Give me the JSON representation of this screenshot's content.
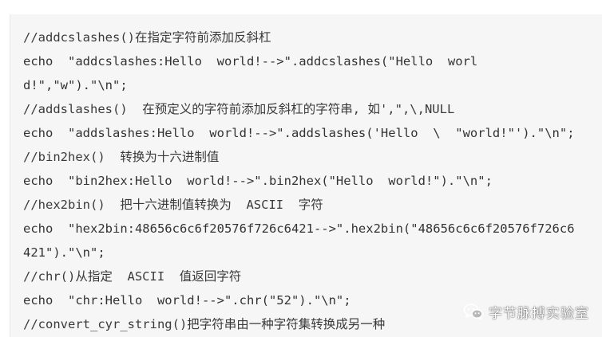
{
  "code": {
    "lines": [
      {
        "kind": "comment",
        "text": "//addcslashes()在指定字符前添加反斜杠"
      },
      {
        "kind": "code",
        "text": "echo  \"addcslashes:Hello  world!-->\".addcslashes(\"Hello  worl"
      },
      {
        "kind": "code",
        "text": "d!\",\"w\").\"\\n\";"
      },
      {
        "kind": "comment",
        "text": "//addslashes()  在预定义的字符前添加反斜杠的字符串, 如',\",\\,NULL"
      },
      {
        "kind": "code",
        "text": "echo  \"addslashes:Hello  world!-->\".addslashes('Hello  \\  \"world!\"').\"\\n\";"
      },
      {
        "kind": "comment",
        "text": "//bin2hex()  转换为十六进制值"
      },
      {
        "kind": "code",
        "text": "echo  \"bin2hex:Hello  world!-->\".bin2hex(\"Hello  world!\").\"\\n\";"
      },
      {
        "kind": "comment",
        "text": "//hex2bin()  把十六进制值转换为  ASCII  字符"
      },
      {
        "kind": "code",
        "text": "echo  \"hex2bin:48656c6c6f20576f726c6421-->\".hex2bin(\"48656c6c6f20576f726c6"
      },
      {
        "kind": "code",
        "text": "421\").\"\\n\";"
      },
      {
        "kind": "comment",
        "text": "//chr()从指定  ASCII  值返回字符"
      },
      {
        "kind": "code",
        "text": "echo  \"chr:Hello  world!-->\".chr(\"52\").\"\\n\";"
      },
      {
        "kind": "comment",
        "text": "//convert_cyr_string()把字符串由一种字符集转换成另一种"
      }
    ]
  },
  "watermark": {
    "label": "字节脉搏实验室",
    "icon": "wechat-icon"
  }
}
